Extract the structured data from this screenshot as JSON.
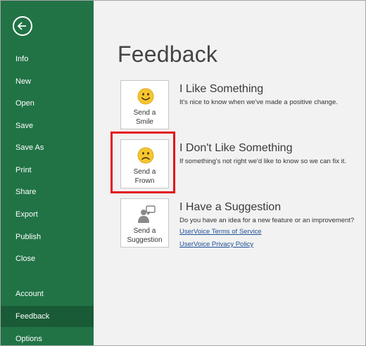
{
  "sidebar": {
    "items": [
      {
        "label": "Info"
      },
      {
        "label": "New"
      },
      {
        "label": "Open"
      },
      {
        "label": "Save"
      },
      {
        "label": "Save As"
      },
      {
        "label": "Print"
      },
      {
        "label": "Share"
      },
      {
        "label": "Export"
      },
      {
        "label": "Publish"
      },
      {
        "label": "Close"
      },
      {
        "label": "Account"
      },
      {
        "label": "Feedback",
        "active": true
      },
      {
        "label": "Options"
      }
    ],
    "back_icon": "arrow-left-circle-icon",
    "bg_color": "#217346",
    "active_color": "#195b36"
  },
  "main": {
    "title": "Feedback",
    "options": [
      {
        "tile_label_line1": "Send a",
        "tile_label_line2": "Smile",
        "icon": "smile-icon",
        "title": "I Like Something",
        "description": "It's nice to know when we've made a positive change."
      },
      {
        "tile_label_line1": "Send a",
        "tile_label_line2": "Frown",
        "icon": "frown-icon",
        "title": "I Don't Like Something",
        "description": "If something's not right we'd like to know so we can fix it.",
        "highlighted": true
      },
      {
        "tile_label_line1": "Send a",
        "tile_label_line2": "Suggestion",
        "icon": "person-speech-icon",
        "title": "I Have a Suggestion",
        "description": "Do you have an idea for a new feature or an improvement?",
        "links": [
          "UserVoice Terms of Service",
          "UserVoice Privacy Policy"
        ]
      }
    ],
    "highlight_color": "#e3141b",
    "link_color": "#1e4e96"
  }
}
